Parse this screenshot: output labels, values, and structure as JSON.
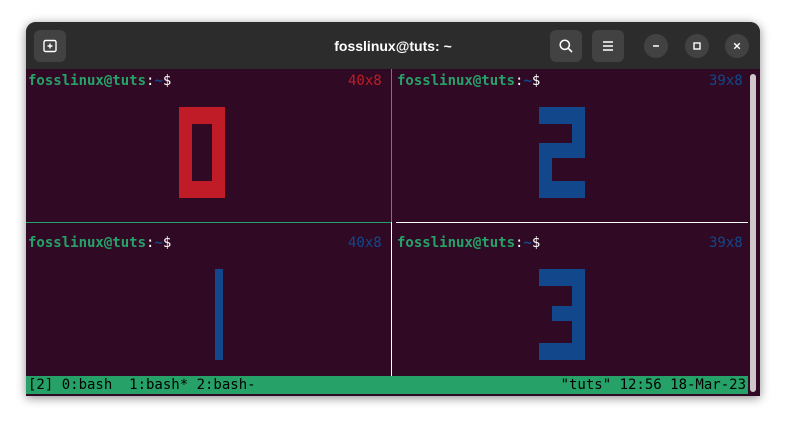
{
  "window": {
    "title": "fosslinux@tuts: ~"
  },
  "titlebar": {
    "new_tab_icon": "new-tab-icon",
    "search_icon": "search-icon",
    "menu_icon": "hamburger-menu-icon",
    "minimize_icon": "minimize-icon",
    "maximize_icon": "maximize-icon",
    "close_icon": "close-icon"
  },
  "prompt": {
    "user_host": "fosslinux@tuts",
    "colon": ":",
    "path": "~",
    "dollar": "$"
  },
  "panes": [
    {
      "id": 0,
      "dims": "40x8",
      "digit": "0",
      "dims_color": "#c01c28",
      "digit_color": "#c01c28"
    },
    {
      "id": 2,
      "dims": "39x8",
      "digit": "2",
      "dims_color": "#12488b",
      "digit_color": "#12488b"
    },
    {
      "id": 1,
      "dims": "40x8",
      "digit": "1",
      "dims_color": "#12488b",
      "digit_color": "#12488b"
    },
    {
      "id": 3,
      "dims": "39x8",
      "digit": "3",
      "dims_color": "#12488b",
      "digit_color": "#12488b"
    }
  ],
  "statusbar": {
    "left": "[2] 0:bash  1:bash* 2:bash-",
    "right": "\"tuts\" 12:56 18-Mar-23"
  },
  "colors": {
    "terminal_bg": "#300a24",
    "titlebar_bg": "#2c2c2c",
    "status_bg": "#26a269",
    "active_border": "#26a269",
    "inactive_border": "#ffffff"
  }
}
